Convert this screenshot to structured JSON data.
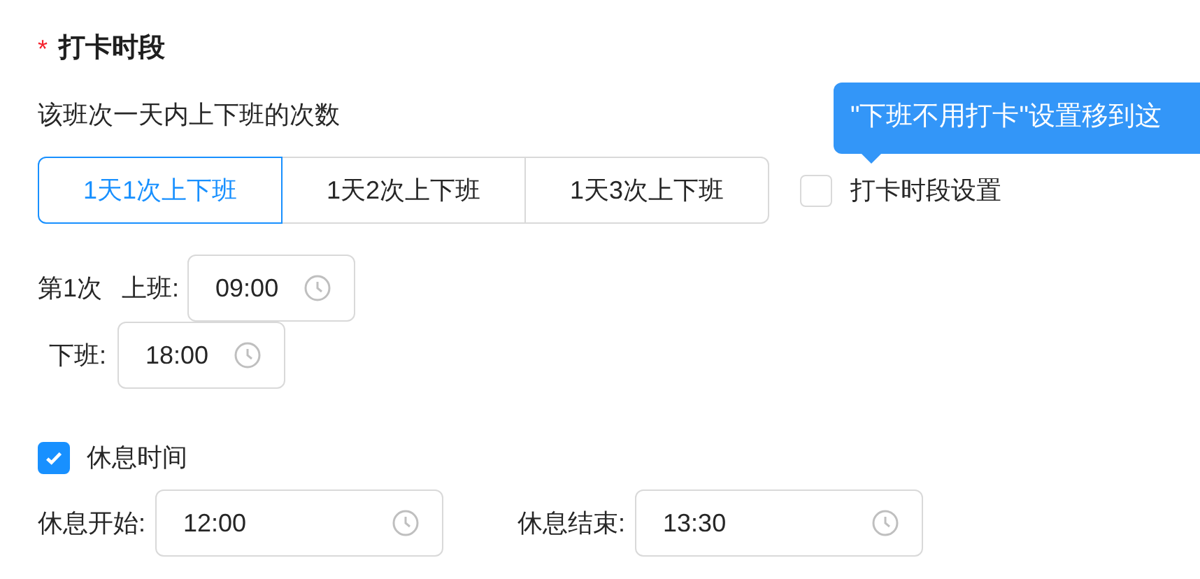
{
  "section": {
    "required_mark": "*",
    "title": "打卡时段"
  },
  "count_label": "该班次一天内上下班的次数",
  "segments": [
    {
      "label": "1天1次上下班",
      "selected": true
    },
    {
      "label": "1天2次上下班",
      "selected": false
    },
    {
      "label": "1天3次上下班",
      "selected": false
    }
  ],
  "period_setting": {
    "label": "打卡时段设置",
    "checked": false
  },
  "tooltip": {
    "text": "\"下班不用打卡\"设置移到这"
  },
  "shifts": [
    {
      "index_label": "第1次",
      "on_label": "上班:",
      "on_time": "09:00",
      "off_label": "下班:",
      "off_time": "18:00"
    }
  ],
  "break": {
    "label": "休息时间",
    "checked": true,
    "start_label": "休息开始:",
    "start_time": "12:00",
    "end_label": "休息结束:",
    "end_time": "13:30"
  }
}
